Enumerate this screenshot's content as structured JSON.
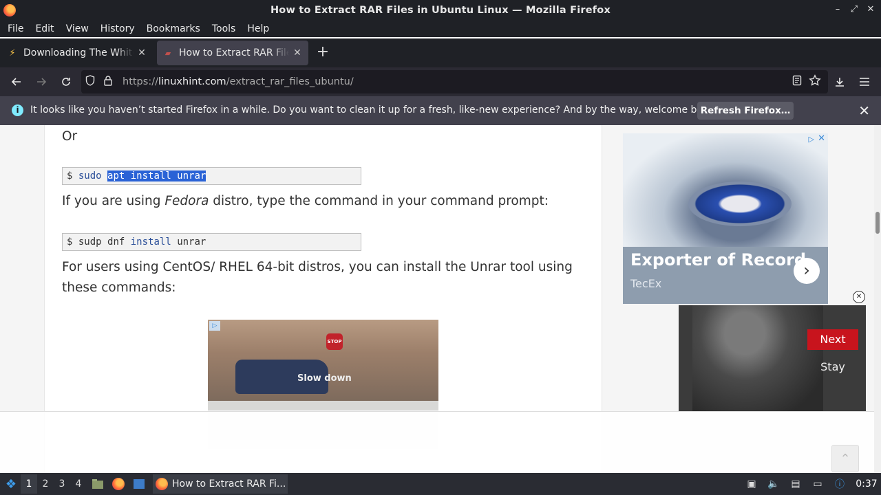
{
  "window": {
    "title": "How to Extract RAR Files in Ubuntu Linux — Mozilla Firefox"
  },
  "menubar": {
    "items": [
      "File",
      "Edit",
      "View",
      "History",
      "Bookmarks",
      "Tools",
      "Help"
    ]
  },
  "tabs": [
    {
      "label": "Downloading The White House",
      "icon": "lightning-icon",
      "active": false
    },
    {
      "label": "How to Extract RAR Files in Ubuntu Linux",
      "icon": "linuxhint-favicon",
      "active": true
    }
  ],
  "navbar": {
    "url_prefix": "https://",
    "url_domain": "linuxhint.com",
    "url_path": "/extract_rar_files_ubuntu/"
  },
  "notification": {
    "message": "It looks like you haven’t started Firefox in a while. Do you want to clean it up for a fresh, like-new experience? And by the way, welcome back!",
    "button": "Refresh Firefox…"
  },
  "article": {
    "or_text": "Or",
    "code1": {
      "prompt": "$",
      "cmd": "sudo",
      "selected": "apt install unrar"
    },
    "fedora_pre": "If you are using ",
    "fedora_em": "Fedora",
    "fedora_post": " distro, type the command in your command prompt:",
    "code2": {
      "prompt": "$",
      "cmd": "sudp dnf",
      "kw": "install",
      "arg": "unrar"
    },
    "centos_line1": "For users using CentOS/ RHEL 64-bit distros, you can install the Unrar tool using",
    "centos_line2": "these commands:"
  },
  "inline_ad": {
    "caption": "Slow down",
    "sign": "STOP"
  },
  "sidebar_ad": {
    "headline": "Exporter of Record",
    "brand": "TecEx"
  },
  "video_ad": {
    "next_label": "Next",
    "stay_label": "Stay"
  },
  "taskbar": {
    "workspaces": [
      "1",
      "2",
      "3",
      "4"
    ],
    "active_workspace": "1",
    "task_label": "How to Extract RAR Fi...",
    "clock": "0:37"
  },
  "colors": {
    "selection": "#2962d6",
    "accent_red": "#c8141d"
  }
}
